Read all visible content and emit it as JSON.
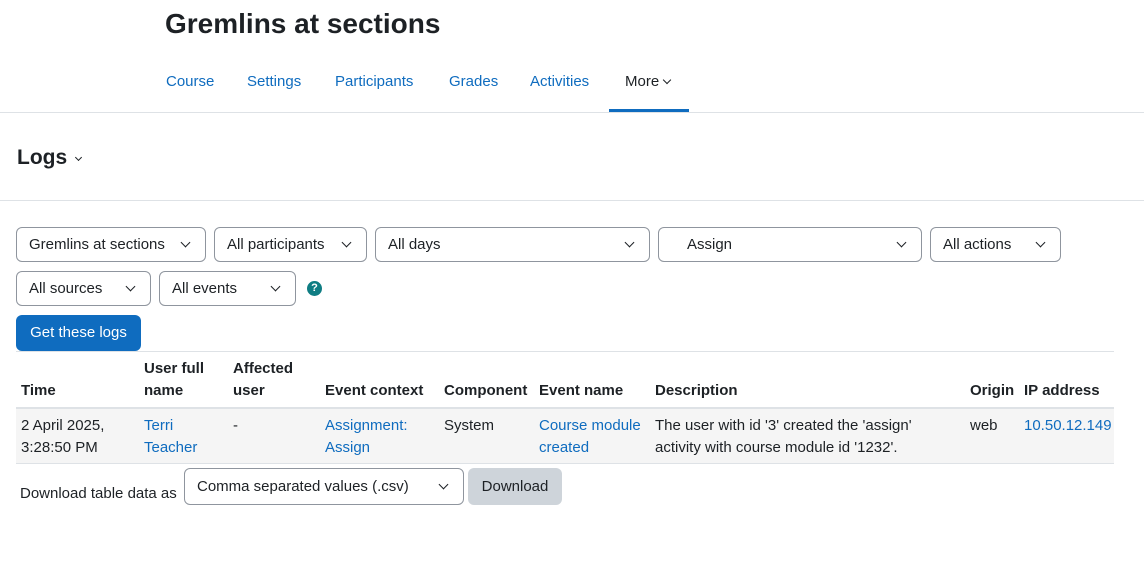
{
  "course": {
    "title": "Gremlins at sections"
  },
  "nav": {
    "items": [
      {
        "label": "Course"
      },
      {
        "label": "Settings"
      },
      {
        "label": "Participants"
      },
      {
        "label": "Grades"
      },
      {
        "label": "Activities"
      },
      {
        "label": "More",
        "active": true
      }
    ]
  },
  "logs": {
    "heading": "Logs"
  },
  "filters": {
    "course": "Gremlins at sections",
    "participants": "All participants",
    "days": "All days",
    "activity": "Assign",
    "actions": "All actions",
    "sources": "All sources",
    "events": "All events",
    "help_glyph": "?",
    "submit_label": "Get these logs"
  },
  "table": {
    "headers": {
      "time": "Time",
      "user_full_name_1": "User full",
      "user_full_name_2": "name",
      "affected_user_1": "Affected",
      "affected_user_2": "user",
      "event_context": "Event context",
      "component": "Component",
      "event_name": "Event name",
      "description": "Description",
      "origin": "Origin",
      "ip_address": "IP address"
    },
    "rows": [
      {
        "time_1": "2 April 2025,",
        "time_2": "3:28:50 PM",
        "user_1": "Terri",
        "user_2": "Teacher",
        "affected_user": "-",
        "event_context_1": "Assignment:",
        "event_context_2": "Assign",
        "component": "System",
        "event_name_1": "Course module",
        "event_name_2": "created",
        "description_1": "The user with id '3' created the 'assign'",
        "description_2": "activity with course module id '1232'.",
        "origin": "web",
        "ip_address": "10.50.12.149"
      }
    ]
  },
  "download": {
    "label": "Download table data as",
    "format": "Comma separated values (.csv)",
    "button_label": "Download"
  },
  "colors": {
    "accent": "#0f6cbf",
    "help": "#0f7d83",
    "text": "#1d2125",
    "border": "#dee2e6"
  }
}
